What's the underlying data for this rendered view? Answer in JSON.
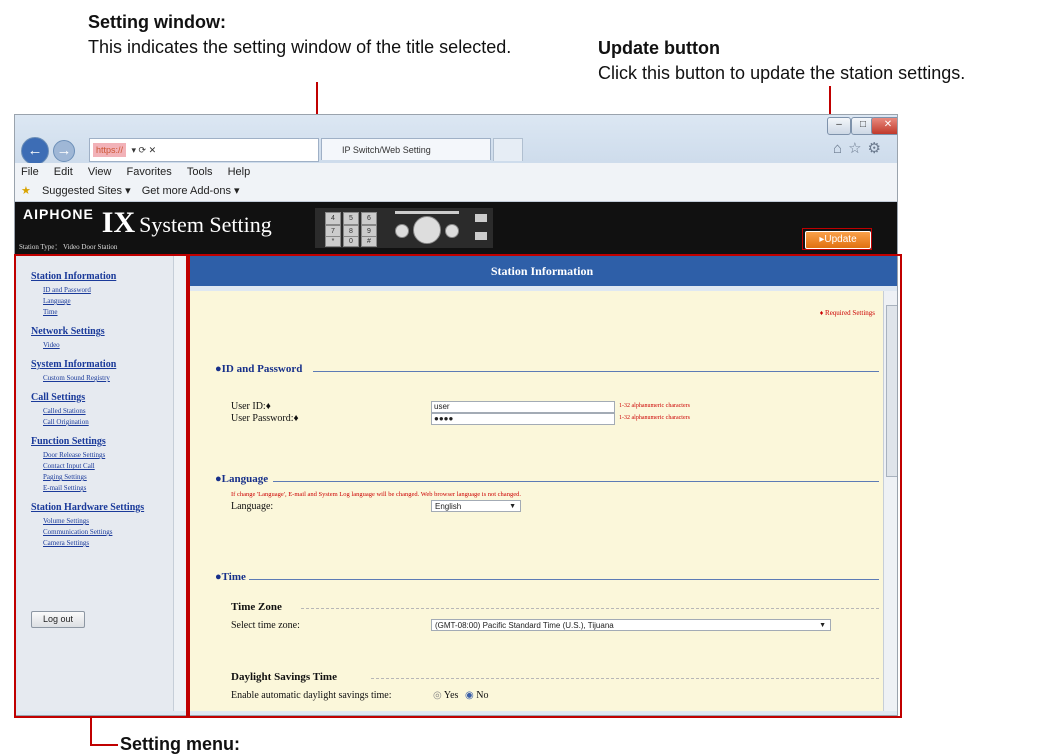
{
  "callouts": {
    "setting_window_title": "Setting window:",
    "setting_window_body": "This indicates the setting window of the title selected.",
    "update_title": "Update button",
    "update_body": "Click this button to update the station settings.",
    "setting_menu_title": "Setting menu:"
  },
  "browser": {
    "address_text": "https://",
    "tab_title": "IP Switch/Web Setting",
    "menu": [
      "File",
      "Edit",
      "View",
      "Favorites",
      "Tools",
      "Help"
    ],
    "favorites": [
      "Suggested Sites ▾",
      "Get more Add-ons ▾"
    ]
  },
  "app": {
    "brand_prefix": "AIPHONE",
    "brand_ix": "IX",
    "brand_rest": "System Setting",
    "station_type": "Station Type： Video Door Station",
    "update_label": "Update",
    "keys": [
      "4",
      "5",
      "6",
      "7",
      "8",
      "9",
      "*",
      "0",
      "#"
    ]
  },
  "sidebar": {
    "sections": [
      {
        "title": "Station Information",
        "items": [
          "ID and Password",
          "Language",
          "Time"
        ]
      },
      {
        "title": "Network Settings",
        "items": [
          "Video"
        ]
      },
      {
        "title": "System Information",
        "items": [
          "Custom Sound Registry"
        ]
      },
      {
        "title": "Call Settings",
        "items": [
          "Called Stations",
          "Call Origination"
        ]
      },
      {
        "title": "Function Settings",
        "items": [
          "Door Release Settings",
          "Contact Input Call",
          "Paging Settings",
          "E-mail Settings"
        ]
      },
      {
        "title": "Station Hardware Settings",
        "items": [
          "Volume Settings",
          "Communication Settings",
          "Camera Settings"
        ]
      }
    ],
    "logout": "Log out"
  },
  "content": {
    "header": "Station Information",
    "required": "♦ Required Settings",
    "id_section": "●ID and Password",
    "user_id_label": "User ID:♦",
    "user_id_value": "user",
    "user_pw_label": "User Password:♦",
    "user_pw_value": "●●●●",
    "hint": "1-32 alphanumeric characters",
    "lang_section": "●Language",
    "lang_note": "If change 'Language', E-mail and System Log language will be changed. Web browser language is not changed.",
    "lang_label": "Language:",
    "lang_value": "English",
    "time_section": "●Time",
    "tz_title": "Time Zone",
    "tz_label": "Select time zone:",
    "tz_value": "(GMT-08:00) Pacific Standard Time (U.S.), Tijuana",
    "dst_title": "Daylight Savings Time",
    "dst_label": "Enable automatic daylight savings time:",
    "dst_yes": "Yes",
    "dst_no": "No"
  },
  "colors": {
    "callout_red": "#c00000",
    "header_blue": "#2e5fa8",
    "update_orange": "#f08a24"
  }
}
